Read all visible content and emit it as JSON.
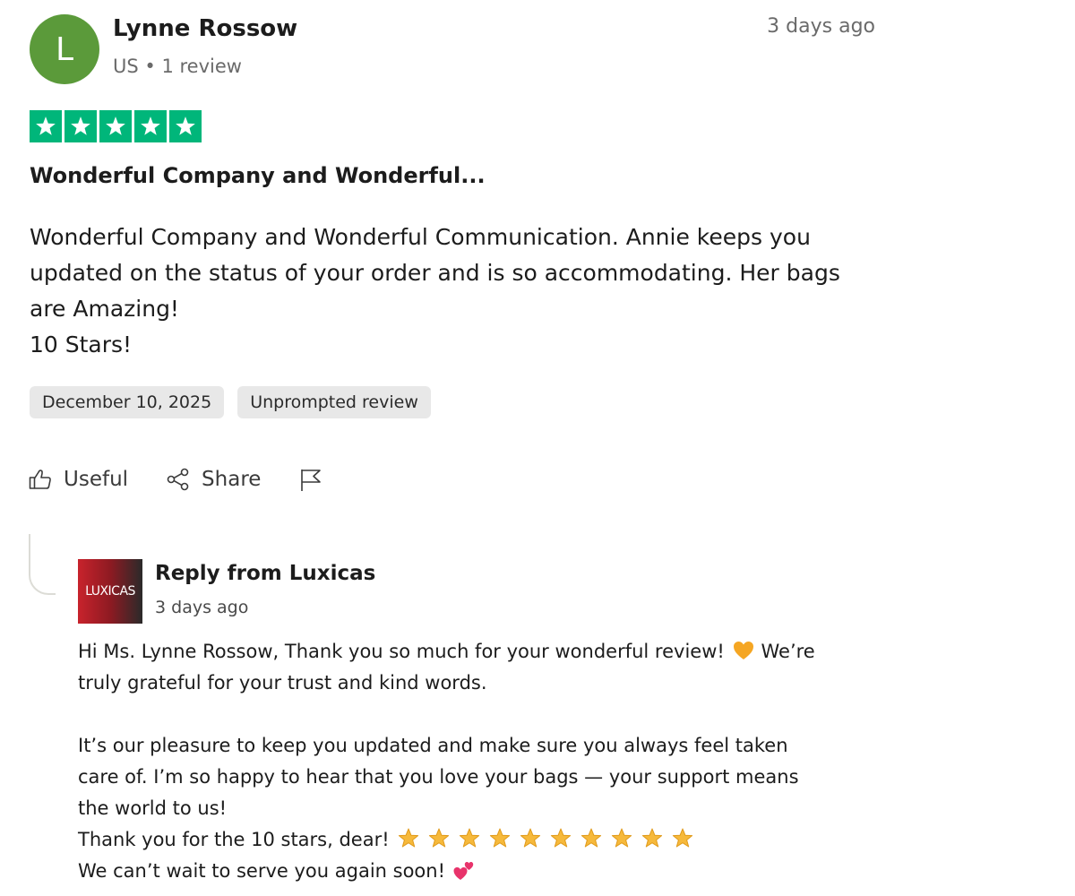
{
  "reviewer": {
    "initial": "L",
    "name": "Lynne Rossow",
    "meta": "US • 1 review",
    "avatar_color": "#5b9a3a"
  },
  "review": {
    "date_relative": "3 days ago",
    "rating": 5,
    "rating_max": 5,
    "star_color": "#00b67a",
    "title": "Wonderful Company and Wonderful...",
    "body_lines": [
      "Wonderful Company and Wonderful Communication. Annie keeps you",
      "updated on the status of your order and is so accommodating. Her bags",
      "are Amazing!",
      "10 Stars!"
    ],
    "tags": [
      "December 10, 2025",
      "Unprompted review"
    ]
  },
  "actions": {
    "useful_label": "Useful",
    "share_label": "Share",
    "flag_icon": "flag-icon"
  },
  "reply": {
    "logo_text": "LUXICAS",
    "title": "Reply from Luxicas",
    "date_relative": "3 days ago",
    "line1": "Hi Ms. Lynne Rossow, Thank you so much for your wonderful review!",
    "line1_end": "We’re",
    "line2": "truly grateful for your trust and kind words.",
    "line3": "It’s our pleasure to keep you updated and make sure you always feel taken",
    "line4": "care of. I’m so happy to hear that you love your bags — your support means",
    "line5": "the world to us!",
    "line6": "Thank you for the 10 stars, dear!",
    "line6_emoji_star_count": 10,
    "line7": "We can’t wait to serve you again soon!",
    "heart_emoji_color": "#f5a623",
    "hearts_emoji_color": "#e8336b"
  }
}
